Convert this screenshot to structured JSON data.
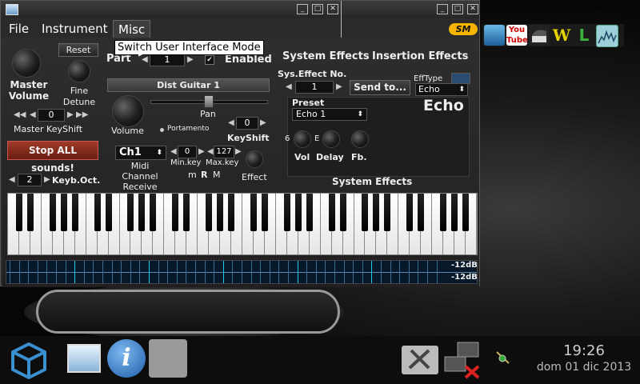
{
  "menu": {
    "file": "File",
    "instrument": "Instrument",
    "misc": "Misc"
  },
  "logo": "SM",
  "tooltip": "Switch User Interface Mode",
  "master": {
    "volume_label": "Master\nVolume",
    "reset_label": "Reset",
    "fine_detune_label": "Fine\nDetune",
    "keyshift_value": "0",
    "keyshift_label": "Master KeyShift",
    "stop_all_label": "Stop ALL sounds!",
    "keyb_oct_value": "2",
    "keyb_oct_label": "Keyb.Oct."
  },
  "part": {
    "label": "Part",
    "number": "1",
    "enabled_label": "Enabled",
    "instrument_name": "Dist Guitar 1",
    "pan_label": "Pan",
    "volume_label": "Volume",
    "portamento_label": "Portamento",
    "keyshift_value": "0",
    "keyshift_label": "KeyShift",
    "channel_value": "Ch1",
    "midi_channel_label": "Midi\nChannel\nReceive",
    "minkey_value": "0",
    "maxkey_value": "127",
    "minkey_label": "Min.key",
    "maxkey_label": "Max.key",
    "m_label": "m",
    "r_label": "R",
    "mm_label": "M",
    "effect_label": "Effect"
  },
  "effects": {
    "system_effects_title": "System Effects",
    "insertion_effects_title": "Insertion Effects",
    "sys_effect_no_label": "Sys.Effect No.",
    "sys_effect_no_value": "1",
    "send_to_label": "Send to...",
    "efftype_label": "EffType",
    "efftype_value": "Echo",
    "preset_label": "Preset",
    "preset_value": "Echo 1",
    "effect_name": "Echo",
    "vol_label": "Vol",
    "delay_label": "Delay",
    "fb_label": "Fb.",
    "knob_side_left": "6",
    "knob_side_mid": "E",
    "footer_label": "System Effects"
  },
  "vu": {
    "top_label": "-12dB",
    "bottom_label": "-12dB"
  },
  "taskbar": {
    "time": "19:26",
    "date": "dom 01 dic 2013"
  },
  "colors": {
    "stop_button": "#8a2a1a",
    "logo": "#f4b400",
    "vu_bg": "#06182a",
    "vu_bright": "#19d0e6"
  }
}
